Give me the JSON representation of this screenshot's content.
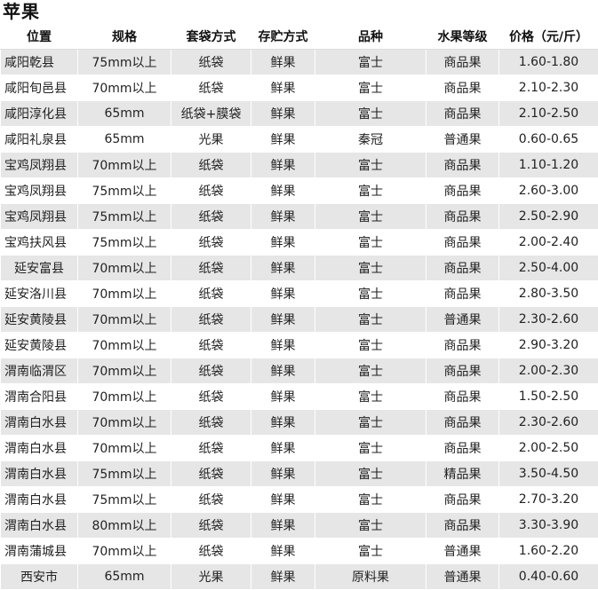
{
  "title": "苹果",
  "headers": [
    "位置",
    "规格",
    "套袋方式",
    "存贮方式",
    "品种",
    "水果等级",
    "价格（元/斤）"
  ],
  "rows": [
    [
      "咸阳乾县",
      "75mm以上",
      "纸袋",
      "鲜果",
      "富士",
      "商品果",
      "1.60-1.80"
    ],
    [
      "咸阳旬邑县",
      "70mm以上",
      "纸袋",
      "鲜果",
      "富士",
      "商品果",
      "2.10-2.30"
    ],
    [
      "咸阳淳化县",
      "65mm",
      "纸袋+膜袋",
      "鲜果",
      "富士",
      "商品果",
      "2.10-2.50"
    ],
    [
      "咸阳礼泉县",
      "65mm",
      "光果",
      "鲜果",
      "秦冠",
      "普通果",
      "0.60-0.65"
    ],
    [
      "宝鸡凤翔县",
      "70mm以上",
      "纸袋",
      "鲜果",
      "富士",
      "商品果",
      "1.10-1.20"
    ],
    [
      "宝鸡凤翔县",
      "75mm以上",
      "纸袋",
      "鲜果",
      "富士",
      "商品果",
      "2.60-3.00"
    ],
    [
      "宝鸡凤翔县",
      "75mm以上",
      "纸袋",
      "鲜果",
      "富士",
      "商品果",
      "2.50-2.90"
    ],
    [
      "宝鸡扶风县",
      "75mm以上",
      "纸袋",
      "鲜果",
      "富士",
      "商品果",
      "2.00-2.40"
    ],
    [
      "延安富县",
      "70mm以上",
      "纸袋",
      "鲜果",
      "富士",
      "商品果",
      "2.50-4.00"
    ],
    [
      "延安洛川县",
      "70mm以上",
      "纸袋",
      "鲜果",
      "富士",
      "商品果",
      "2.80-3.50"
    ],
    [
      "延安黄陵县",
      "70mm以上",
      "纸袋",
      "鲜果",
      "富士",
      "普通果",
      "2.30-2.60"
    ],
    [
      "延安黄陵县",
      "70mm以上",
      "纸袋",
      "鲜果",
      "富士",
      "商品果",
      "2.90-3.20"
    ],
    [
      "渭南临渭区",
      "70mm以上",
      "纸袋",
      "鲜果",
      "富士",
      "商品果",
      "2.00-2.30"
    ],
    [
      "渭南合阳县",
      "70mm以上",
      "纸袋",
      "鲜果",
      "富士",
      "商品果",
      "1.50-2.50"
    ],
    [
      "渭南白水县",
      "70mm以上",
      "纸袋",
      "鲜果",
      "富士",
      "商品果",
      "2.30-2.60"
    ],
    [
      "渭南白水县",
      "70mm以上",
      "纸袋",
      "鲜果",
      "富士",
      "商品果",
      "2.00-2.50"
    ],
    [
      "渭南白水县",
      "75mm以上",
      "纸袋",
      "鲜果",
      "富士",
      "精品果",
      "3.50-4.50"
    ],
    [
      "渭南白水县",
      "75mm以上",
      "纸袋",
      "鲜果",
      "富士",
      "商品果",
      "2.70-3.20"
    ],
    [
      "渭南白水县",
      "80mm以上",
      "纸袋",
      "鲜果",
      "富士",
      "商品果",
      "3.30-3.90"
    ],
    [
      "渭南蒲城县",
      "70mm以上",
      "纸袋",
      "鲜果",
      "富士",
      "普通果",
      "1.60-2.20"
    ],
    [
      "西安市",
      "65mm",
      "光果",
      "鲜果",
      "原料果",
      "普通果",
      "0.40-0.60"
    ]
  ]
}
